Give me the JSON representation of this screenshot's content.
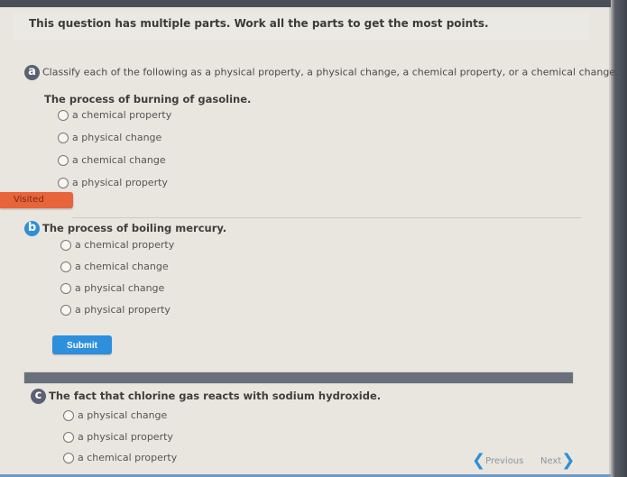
{
  "intro": "This question has multiple parts. Work all the parts to get the most points.",
  "part_a": {
    "badge": "a",
    "instructions": "Classify each of the following as a physical property, a physical change, a chemical property, or a chemical change.",
    "question": "The process of burning of gasoline.",
    "options": [
      "a chemical property",
      "a physical change",
      "a chemical change",
      "a physical property"
    ]
  },
  "visited_label": "Visited",
  "part_b": {
    "badge": "b",
    "question": "The process of boiling mercury.",
    "options": [
      "a chemical property",
      "a chemical change",
      "a physical change",
      "a physical property"
    ]
  },
  "submit_label": "Submit",
  "part_c": {
    "badge": "c",
    "question": "The fact that chlorine gas reacts with sodium hydroxide.",
    "options": [
      "a physical change",
      "a physical property",
      "a chemical property"
    ]
  },
  "nav": {
    "previous": "Previous",
    "next": "Next"
  },
  "colors": {
    "accent": "#2f8fd6",
    "visited": "#e8643a",
    "badge_gray": "#5b6172"
  }
}
